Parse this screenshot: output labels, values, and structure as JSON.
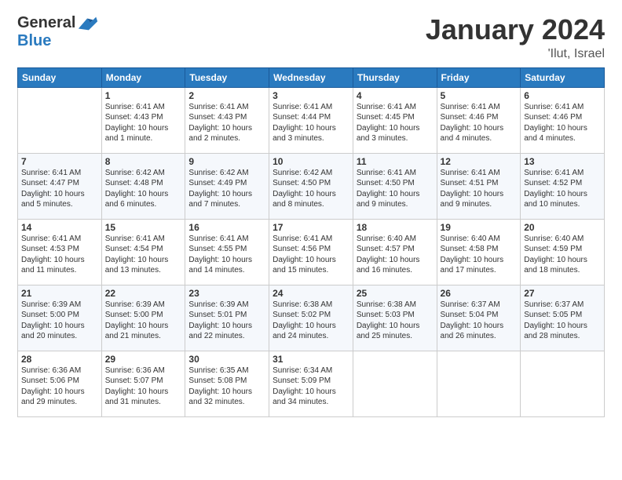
{
  "header": {
    "logo_general": "General",
    "logo_blue": "Blue",
    "title": "January 2024",
    "subtitle": "'Ilut, Israel"
  },
  "columns": [
    "Sunday",
    "Monday",
    "Tuesday",
    "Wednesday",
    "Thursday",
    "Friday",
    "Saturday"
  ],
  "weeks": [
    [
      {
        "day": "",
        "sunrise": "",
        "sunset": "",
        "daylight": ""
      },
      {
        "day": "1",
        "sunrise": "Sunrise: 6:41 AM",
        "sunset": "Sunset: 4:43 PM",
        "daylight": "Daylight: 10 hours and 1 minute."
      },
      {
        "day": "2",
        "sunrise": "Sunrise: 6:41 AM",
        "sunset": "Sunset: 4:43 PM",
        "daylight": "Daylight: 10 hours and 2 minutes."
      },
      {
        "day": "3",
        "sunrise": "Sunrise: 6:41 AM",
        "sunset": "Sunset: 4:44 PM",
        "daylight": "Daylight: 10 hours and 3 minutes."
      },
      {
        "day": "4",
        "sunrise": "Sunrise: 6:41 AM",
        "sunset": "Sunset: 4:45 PM",
        "daylight": "Daylight: 10 hours and 3 minutes."
      },
      {
        "day": "5",
        "sunrise": "Sunrise: 6:41 AM",
        "sunset": "Sunset: 4:46 PM",
        "daylight": "Daylight: 10 hours and 4 minutes."
      },
      {
        "day": "6",
        "sunrise": "Sunrise: 6:41 AM",
        "sunset": "Sunset: 4:46 PM",
        "daylight": "Daylight: 10 hours and 4 minutes."
      }
    ],
    [
      {
        "day": "7",
        "sunrise": "Sunrise: 6:41 AM",
        "sunset": "Sunset: 4:47 PM",
        "daylight": "Daylight: 10 hours and 5 minutes."
      },
      {
        "day": "8",
        "sunrise": "Sunrise: 6:42 AM",
        "sunset": "Sunset: 4:48 PM",
        "daylight": "Daylight: 10 hours and 6 minutes."
      },
      {
        "day": "9",
        "sunrise": "Sunrise: 6:42 AM",
        "sunset": "Sunset: 4:49 PM",
        "daylight": "Daylight: 10 hours and 7 minutes."
      },
      {
        "day": "10",
        "sunrise": "Sunrise: 6:42 AM",
        "sunset": "Sunset: 4:50 PM",
        "daylight": "Daylight: 10 hours and 8 minutes."
      },
      {
        "day": "11",
        "sunrise": "Sunrise: 6:41 AM",
        "sunset": "Sunset: 4:50 PM",
        "daylight": "Daylight: 10 hours and 9 minutes."
      },
      {
        "day": "12",
        "sunrise": "Sunrise: 6:41 AM",
        "sunset": "Sunset: 4:51 PM",
        "daylight": "Daylight: 10 hours and 9 minutes."
      },
      {
        "day": "13",
        "sunrise": "Sunrise: 6:41 AM",
        "sunset": "Sunset: 4:52 PM",
        "daylight": "Daylight: 10 hours and 10 minutes."
      }
    ],
    [
      {
        "day": "14",
        "sunrise": "Sunrise: 6:41 AM",
        "sunset": "Sunset: 4:53 PM",
        "daylight": "Daylight: 10 hours and 11 minutes."
      },
      {
        "day": "15",
        "sunrise": "Sunrise: 6:41 AM",
        "sunset": "Sunset: 4:54 PM",
        "daylight": "Daylight: 10 hours and 13 minutes."
      },
      {
        "day": "16",
        "sunrise": "Sunrise: 6:41 AM",
        "sunset": "Sunset: 4:55 PM",
        "daylight": "Daylight: 10 hours and 14 minutes."
      },
      {
        "day": "17",
        "sunrise": "Sunrise: 6:41 AM",
        "sunset": "Sunset: 4:56 PM",
        "daylight": "Daylight: 10 hours and 15 minutes."
      },
      {
        "day": "18",
        "sunrise": "Sunrise: 6:40 AM",
        "sunset": "Sunset: 4:57 PM",
        "daylight": "Daylight: 10 hours and 16 minutes."
      },
      {
        "day": "19",
        "sunrise": "Sunrise: 6:40 AM",
        "sunset": "Sunset: 4:58 PM",
        "daylight": "Daylight: 10 hours and 17 minutes."
      },
      {
        "day": "20",
        "sunrise": "Sunrise: 6:40 AM",
        "sunset": "Sunset: 4:59 PM",
        "daylight": "Daylight: 10 hours and 18 minutes."
      }
    ],
    [
      {
        "day": "21",
        "sunrise": "Sunrise: 6:39 AM",
        "sunset": "Sunset: 5:00 PM",
        "daylight": "Daylight: 10 hours and 20 minutes."
      },
      {
        "day": "22",
        "sunrise": "Sunrise: 6:39 AM",
        "sunset": "Sunset: 5:00 PM",
        "daylight": "Daylight: 10 hours and 21 minutes."
      },
      {
        "day": "23",
        "sunrise": "Sunrise: 6:39 AM",
        "sunset": "Sunset: 5:01 PM",
        "daylight": "Daylight: 10 hours and 22 minutes."
      },
      {
        "day": "24",
        "sunrise": "Sunrise: 6:38 AM",
        "sunset": "Sunset: 5:02 PM",
        "daylight": "Daylight: 10 hours and 24 minutes."
      },
      {
        "day": "25",
        "sunrise": "Sunrise: 6:38 AM",
        "sunset": "Sunset: 5:03 PM",
        "daylight": "Daylight: 10 hours and 25 minutes."
      },
      {
        "day": "26",
        "sunrise": "Sunrise: 6:37 AM",
        "sunset": "Sunset: 5:04 PM",
        "daylight": "Daylight: 10 hours and 26 minutes."
      },
      {
        "day": "27",
        "sunrise": "Sunrise: 6:37 AM",
        "sunset": "Sunset: 5:05 PM",
        "daylight": "Daylight: 10 hours and 28 minutes."
      }
    ],
    [
      {
        "day": "28",
        "sunrise": "Sunrise: 6:36 AM",
        "sunset": "Sunset: 5:06 PM",
        "daylight": "Daylight: 10 hours and 29 minutes."
      },
      {
        "day": "29",
        "sunrise": "Sunrise: 6:36 AM",
        "sunset": "Sunset: 5:07 PM",
        "daylight": "Daylight: 10 hours and 31 minutes."
      },
      {
        "day": "30",
        "sunrise": "Sunrise: 6:35 AM",
        "sunset": "Sunset: 5:08 PM",
        "daylight": "Daylight: 10 hours and 32 minutes."
      },
      {
        "day": "31",
        "sunrise": "Sunrise: 6:34 AM",
        "sunset": "Sunset: 5:09 PM",
        "daylight": "Daylight: 10 hours and 34 minutes."
      },
      {
        "day": "",
        "sunrise": "",
        "sunset": "",
        "daylight": ""
      },
      {
        "day": "",
        "sunrise": "",
        "sunset": "",
        "daylight": ""
      },
      {
        "day": "",
        "sunrise": "",
        "sunset": "",
        "daylight": ""
      }
    ]
  ]
}
